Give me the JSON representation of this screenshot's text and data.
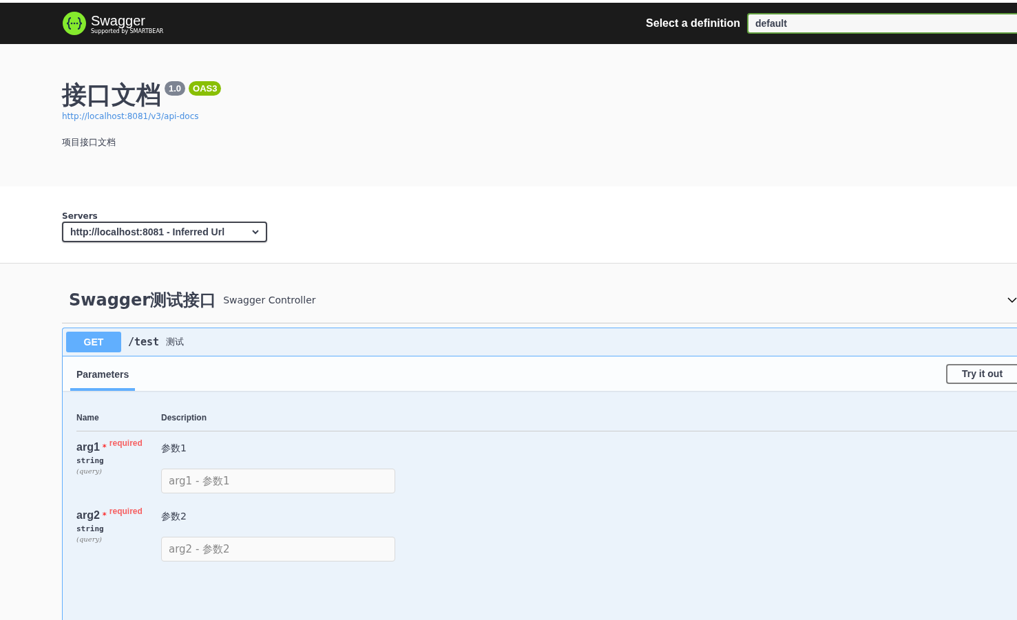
{
  "topbar": {
    "logo_name": "Swagger",
    "logo_tagline": "Supported by SMARTBEAR",
    "definition_label": "Select a definition",
    "definition_value": "default"
  },
  "info": {
    "title": "接口文档",
    "version": "1.0",
    "oas": "OAS3",
    "url": "http://localhost:8081/v3/api-docs",
    "description": "项目接口文档"
  },
  "servers": {
    "label": "Servers",
    "selected": "http://localhost:8081 - Inferred Url"
  },
  "tag": {
    "name": "Swagger测试接口",
    "description": "Swagger Controller",
    "expanded": true
  },
  "operation": {
    "method": "GET",
    "path": "/test",
    "summary": "测试",
    "expanded": true,
    "tabs": [
      {
        "label": "Parameters",
        "selected": true
      }
    ],
    "try_button": "Try it out",
    "columns": [
      "Name",
      "Description"
    ],
    "parameters": [
      {
        "name": "arg1",
        "required_mark": "*",
        "required": "required",
        "type": "string",
        "location": "(query)",
        "description": "参数1",
        "placeholder": "arg1 - 参数1"
      },
      {
        "name": "arg2",
        "required_mark": "*",
        "required": "required",
        "type": "string",
        "location": "(query)",
        "description": "参数2",
        "placeholder": "arg2 - 参数2"
      }
    ]
  }
}
